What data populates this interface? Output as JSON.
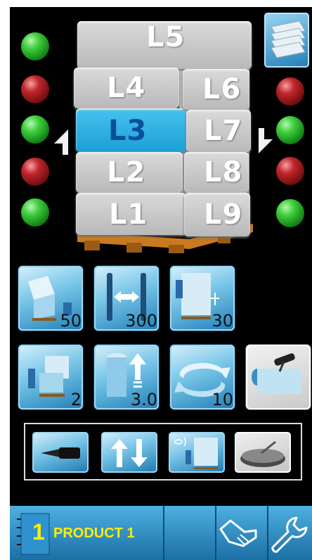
{
  "pallet": {
    "layers_left": [
      "L1",
      "L2",
      "L3",
      "L4"
    ],
    "layer_top": "L5",
    "layers_right": [
      "L6",
      "L7",
      "L8",
      "L9"
    ],
    "selected_layer": "L3"
  },
  "leds_left": [
    "green",
    "red",
    "green",
    "red",
    "green"
  ],
  "leds_right": [
    "red",
    "green",
    "red",
    "green"
  ],
  "tiles_row1": [
    {
      "name": "film-stretch",
      "value": "50"
    },
    {
      "name": "film-width",
      "value": "300"
    },
    {
      "name": "top-height",
      "value": "30"
    }
  ],
  "tiles_row2": [
    {
      "name": "layer-overlap",
      "value": "2"
    },
    {
      "name": "prestretch",
      "value": "3.0"
    },
    {
      "name": "rotations",
      "value": "10"
    },
    {
      "name": "film-cutter",
      "value": ""
    }
  ],
  "tool_row": [
    "film-clamp",
    "carriage-up-down",
    "photocell-pallet",
    "turntable"
  ],
  "bottom_bar": {
    "program_number": "1",
    "program_label": "PRODUCT 1",
    "icons": [
      "manual-hand-icon",
      "wrench-icon"
    ]
  },
  "colors": {
    "accent": "#3bb0e0",
    "selected_layer": "#29aee0",
    "text_highlight": "#ffee00"
  }
}
